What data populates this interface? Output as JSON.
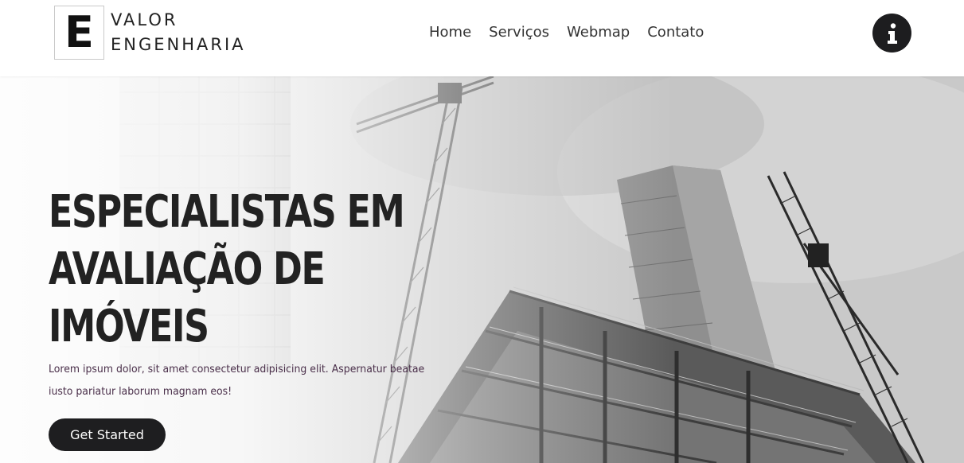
{
  "logo": {
    "letter": "E",
    "line1": "VALOR",
    "line2": "ENGENHARIA"
  },
  "nav": {
    "items": [
      "Home",
      "Serviços",
      "Webmap",
      "Contato"
    ]
  },
  "info_button": {
    "icon": "info-icon"
  },
  "hero": {
    "title_lines": [
      "ESPECIALISTAS EM",
      "AVALIAÇÃO DE",
      "IMÓVEIS"
    ],
    "description_lines": [
      "Lorem ipsum dolor, sit amet consectetur adipisicing elit. Aspernatur beatae",
      "iusto pariatur laborum magnam eos!"
    ],
    "cta_label": "Get Started",
    "background": "construction-cranes-photo"
  },
  "colors": {
    "header_bg": "#ffffff",
    "button_dark": "#1e1e20",
    "title_text": "#222222",
    "body_text": "#4a2f4a"
  }
}
